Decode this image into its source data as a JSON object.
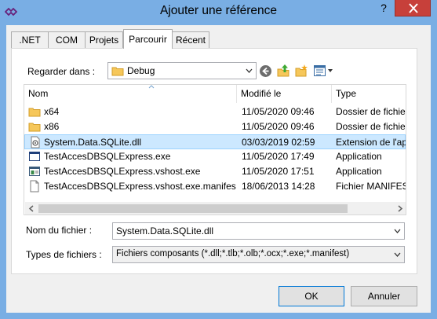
{
  "window": {
    "title": "Ajouter une référence",
    "help_label": "?",
    "close_icon": "close-icon"
  },
  "tabs": [
    {
      "label": ".NET"
    },
    {
      "label": "COM"
    },
    {
      "label": "Projets"
    },
    {
      "label": "Parcourir",
      "active": true
    },
    {
      "label": "Récent"
    }
  ],
  "look_in": {
    "label": "Regarder dans :",
    "value": "Debug"
  },
  "file_list": {
    "columns": [
      "Nom",
      "Modifié le",
      "Type"
    ],
    "rows": [
      {
        "name": "x64",
        "modified": "11/05/2020 09:46",
        "type": "Dossier de fichiers",
        "icon": "folder-icon"
      },
      {
        "name": "x86",
        "modified": "11/05/2020 09:46",
        "type": "Dossier de fichiers",
        "icon": "folder-icon"
      },
      {
        "name": "System.Data.SQLite.dll",
        "modified": "03/03/2019 02:59",
        "type": "Extension de l'application",
        "icon": "dll-file-icon",
        "selected": true
      },
      {
        "name": "TestAccesDBSQLExpress.exe",
        "modified": "11/05/2020 17:49",
        "type": "Application",
        "icon": "exe-window-icon"
      },
      {
        "name": "TestAccesDBSQLExpress.vshost.exe",
        "modified": "11/05/2020 17:51",
        "type": "Application",
        "icon": "exe-app-icon"
      },
      {
        "name": "TestAccesDBSQLExpress.vshost.exe.manifest",
        "modified": "18/06/2013 14:28",
        "type": "Fichier MANIFEST",
        "icon": "blank-file-icon"
      }
    ]
  },
  "file_name": {
    "label": "Nom du fichier :",
    "value": "System.Data.SQLite.dll"
  },
  "file_types": {
    "label": "Types de fichiers :",
    "value": "Fichiers composants (*.dll;*.tlb;*.olb;*.ocx;*.exe;*.manifest)"
  },
  "buttons": {
    "ok": "OK",
    "cancel": "Annuler"
  },
  "colors": {
    "title_bar": "#79aee4",
    "close_button": "#c7403a",
    "selection": "#cce8ff",
    "default_button_border": "#0078d7"
  }
}
